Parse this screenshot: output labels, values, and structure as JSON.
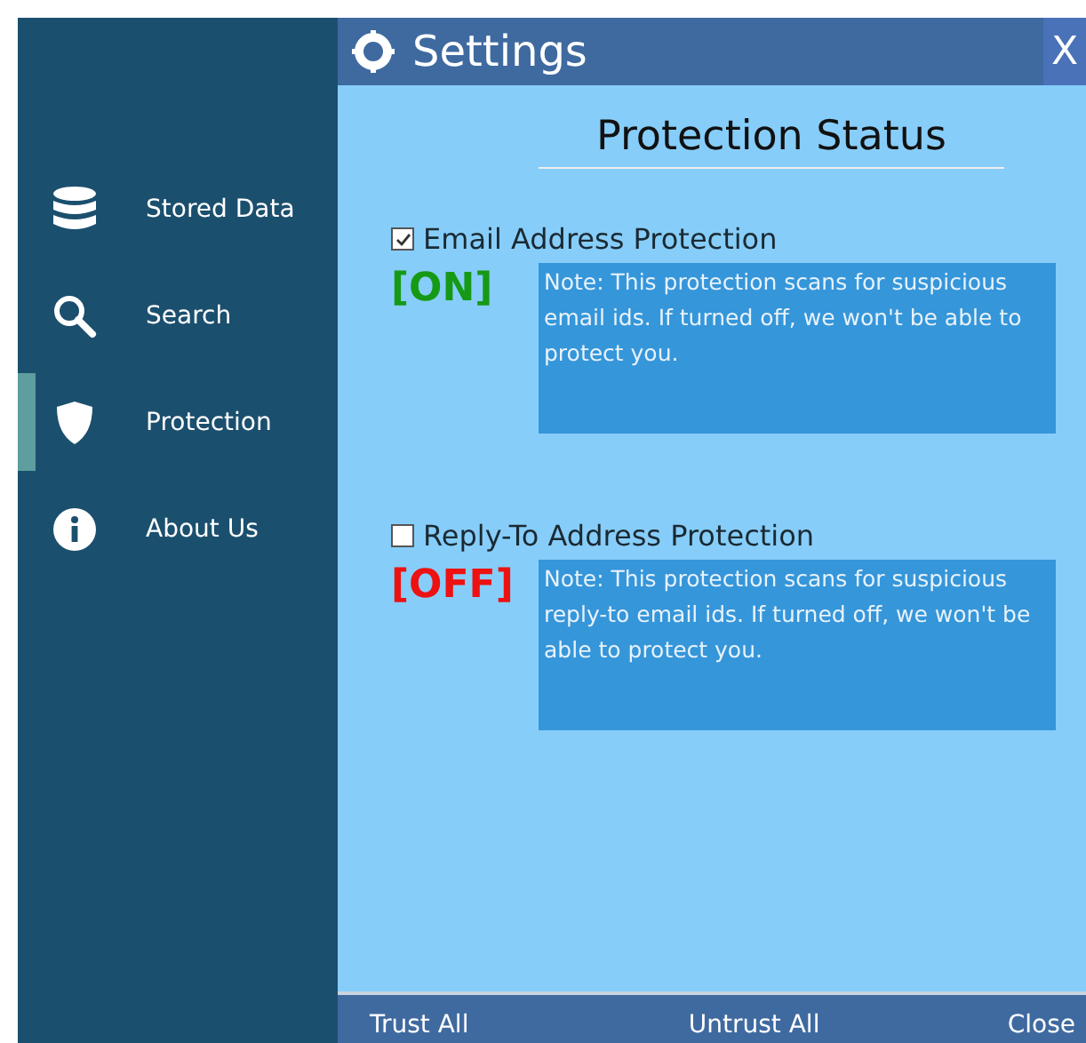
{
  "sidebar": {
    "items": [
      {
        "label": "Stored Data",
        "kind": "database",
        "selected": false
      },
      {
        "label": "Search",
        "kind": "search",
        "selected": false
      },
      {
        "label": "Protection",
        "kind": "shield",
        "selected": true
      },
      {
        "label": "About Us",
        "kind": "info",
        "selected": false
      }
    ]
  },
  "window": {
    "title": "Settings",
    "close": "X"
  },
  "heading": "Protection Status",
  "protections": [
    {
      "label": "Email Address Protection",
      "checked": true,
      "status": "[ON]",
      "note": "Note: This protection scans for suspicious email ids. If turned off, we won't be able to protect you."
    },
    {
      "label": "Reply-To Address Protection",
      "checked": false,
      "status": "[OFF]",
      "note": "Note: This protection scans for suspicious reply-to email ids. If turned off, we won't be able to protect you."
    }
  ],
  "buttons": [
    "Trust All",
    "Untrust All",
    "Close"
  ]
}
